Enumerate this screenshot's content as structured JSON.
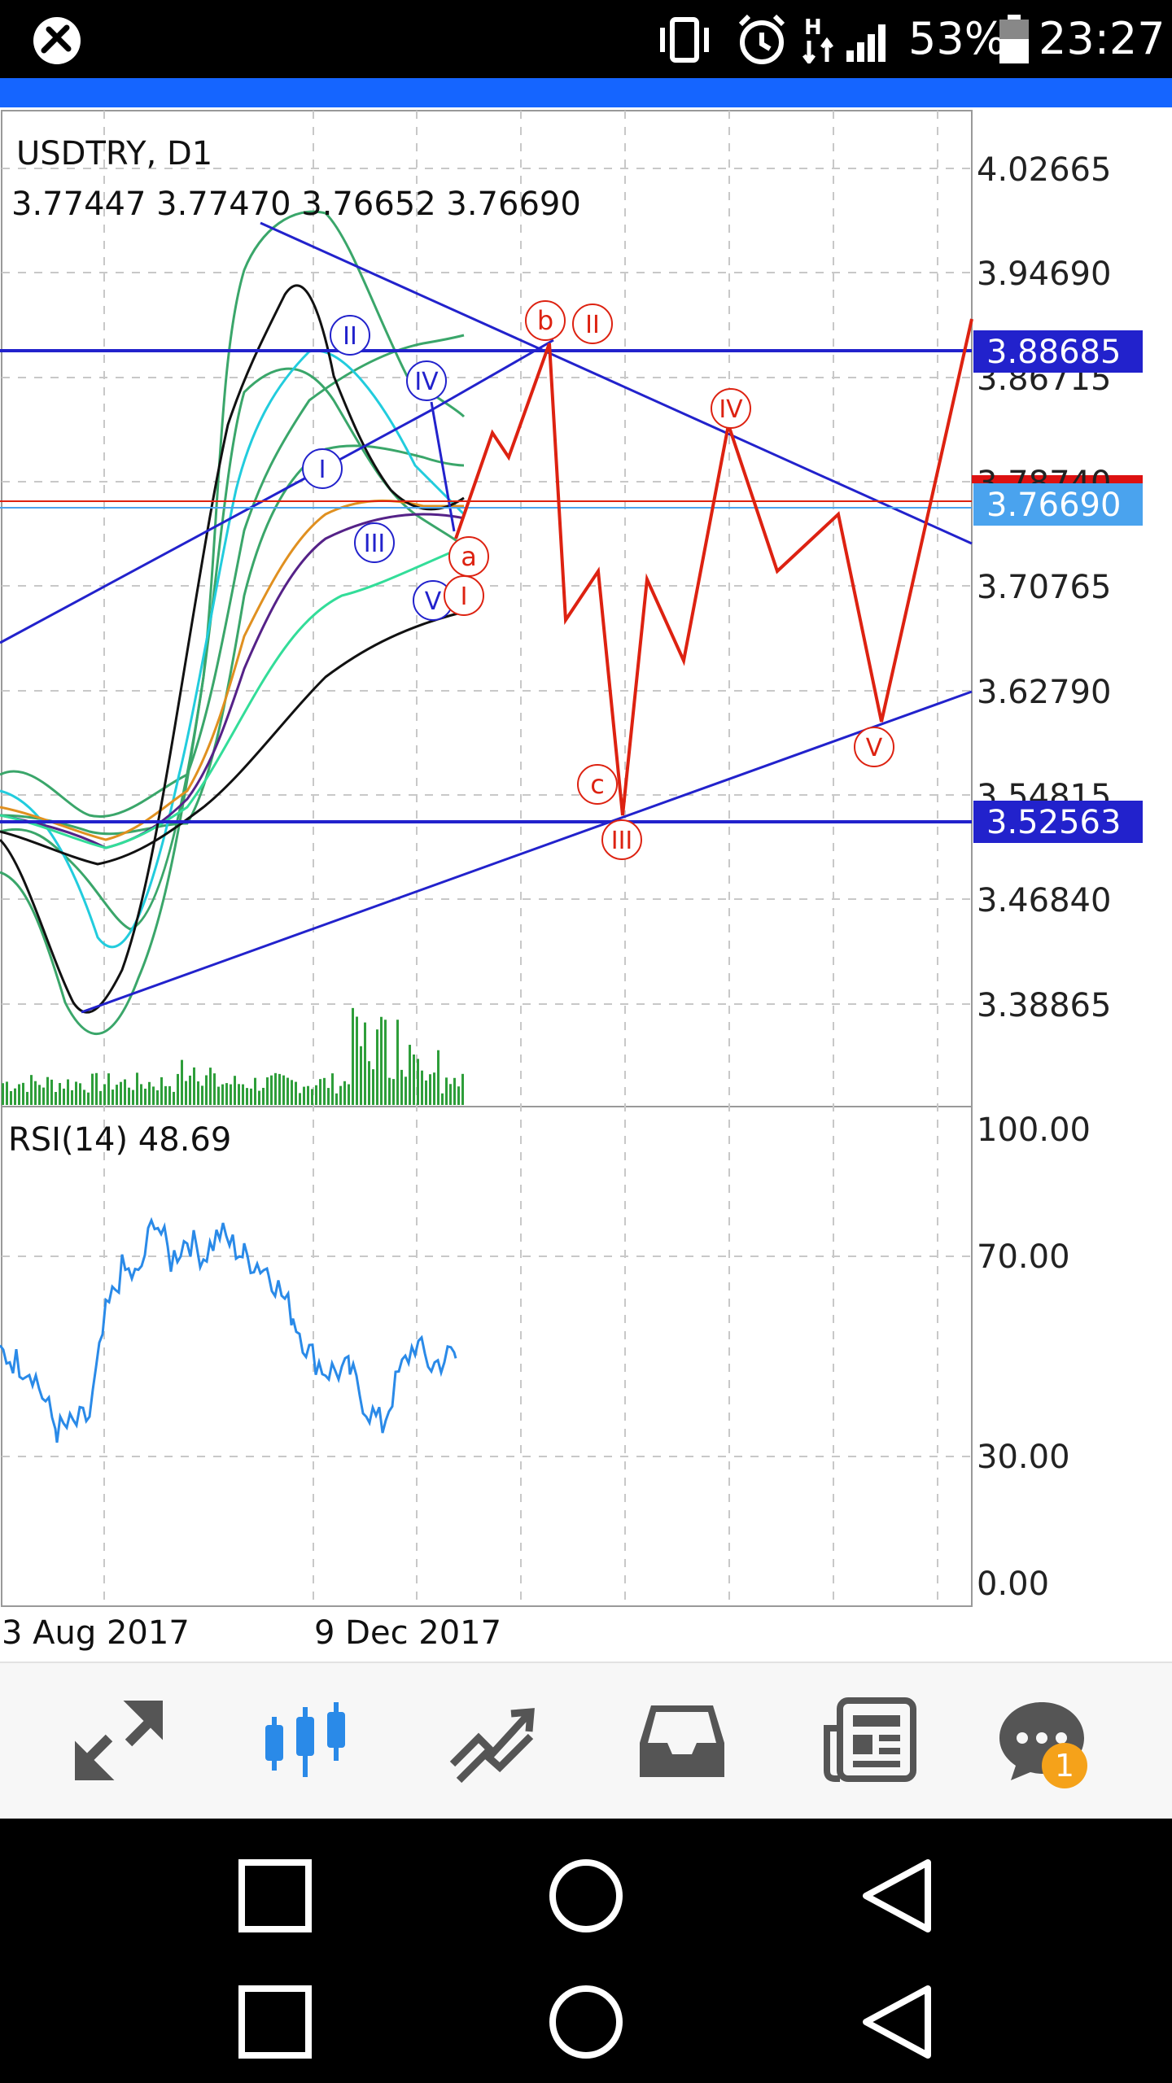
{
  "status_bar": {
    "battery": "53%",
    "time": "23:27",
    "signal_badge": "H",
    "icons": [
      "metatrader-icon",
      "vibrate-icon",
      "alarm-icon",
      "data-arrows-icon",
      "signal-icon",
      "battery-icon"
    ]
  },
  "chart": {
    "symbol_timeframe": "USDTRY, D1",
    "ohlc": "3.77447 3.77470 3.76652 3.76690",
    "price_ticks": [
      "4.02665",
      "3.94690",
      "3.86715",
      "3.78740",
      "3.70765",
      "3.62790",
      "3.54815",
      "3.46840",
      "3.38865"
    ],
    "price_boxes": {
      "resistance": "3.88685",
      "current": "3.76690",
      "support": "3.52563"
    },
    "rsi_label": "RSI(14) 48.69",
    "rsi_ticks": [
      "100.00",
      "70.00",
      "30.00",
      "0.00"
    ],
    "dates": [
      "3 Aug 2017",
      "9 Dec 2017"
    ],
    "wave_labels_blue": [
      "II",
      "IV",
      "I",
      "III",
      "V"
    ],
    "wave_labels_red": [
      "b",
      "II",
      "a",
      "I",
      "IV",
      "c",
      "III",
      "V"
    ],
    "colors": {
      "resistance_line": "#2222cc",
      "forecast": "#dd2211",
      "rsi": "#2a8ae8",
      "volume": "#2e9e3a",
      "bollinger": "#3aa66a",
      "current_box": "#4aa3ee"
    }
  },
  "chart_data": {
    "type": "candlestick",
    "title": "USDTRY, D1",
    "ohlc_last": {
      "open": 3.77447,
      "high": 3.7747,
      "low": 3.76652,
      "close": 3.7669
    },
    "y_range": [
      3.35,
      4.06
    ],
    "horizontal_levels": [
      3.88685,
      3.52563
    ],
    "current_price": 3.7669,
    "rsi": {
      "name": "RSI(14)",
      "value": 48.69,
      "range": [
        0,
        100
      ],
      "levels": [
        30,
        70
      ]
    },
    "x_labels": [
      "3 Aug 2017",
      "9 Dec 2017"
    ]
  },
  "bottom_nav": {
    "items": [
      "quotes-icon",
      "chart-icon",
      "trade-icon",
      "history-icon",
      "news-icon",
      "chat-icon"
    ],
    "chat_badge": "1"
  },
  "system_nav": [
    "recents-icon",
    "home-icon",
    "back-icon",
    "recents-icon",
    "home-icon",
    "back-icon"
  ]
}
